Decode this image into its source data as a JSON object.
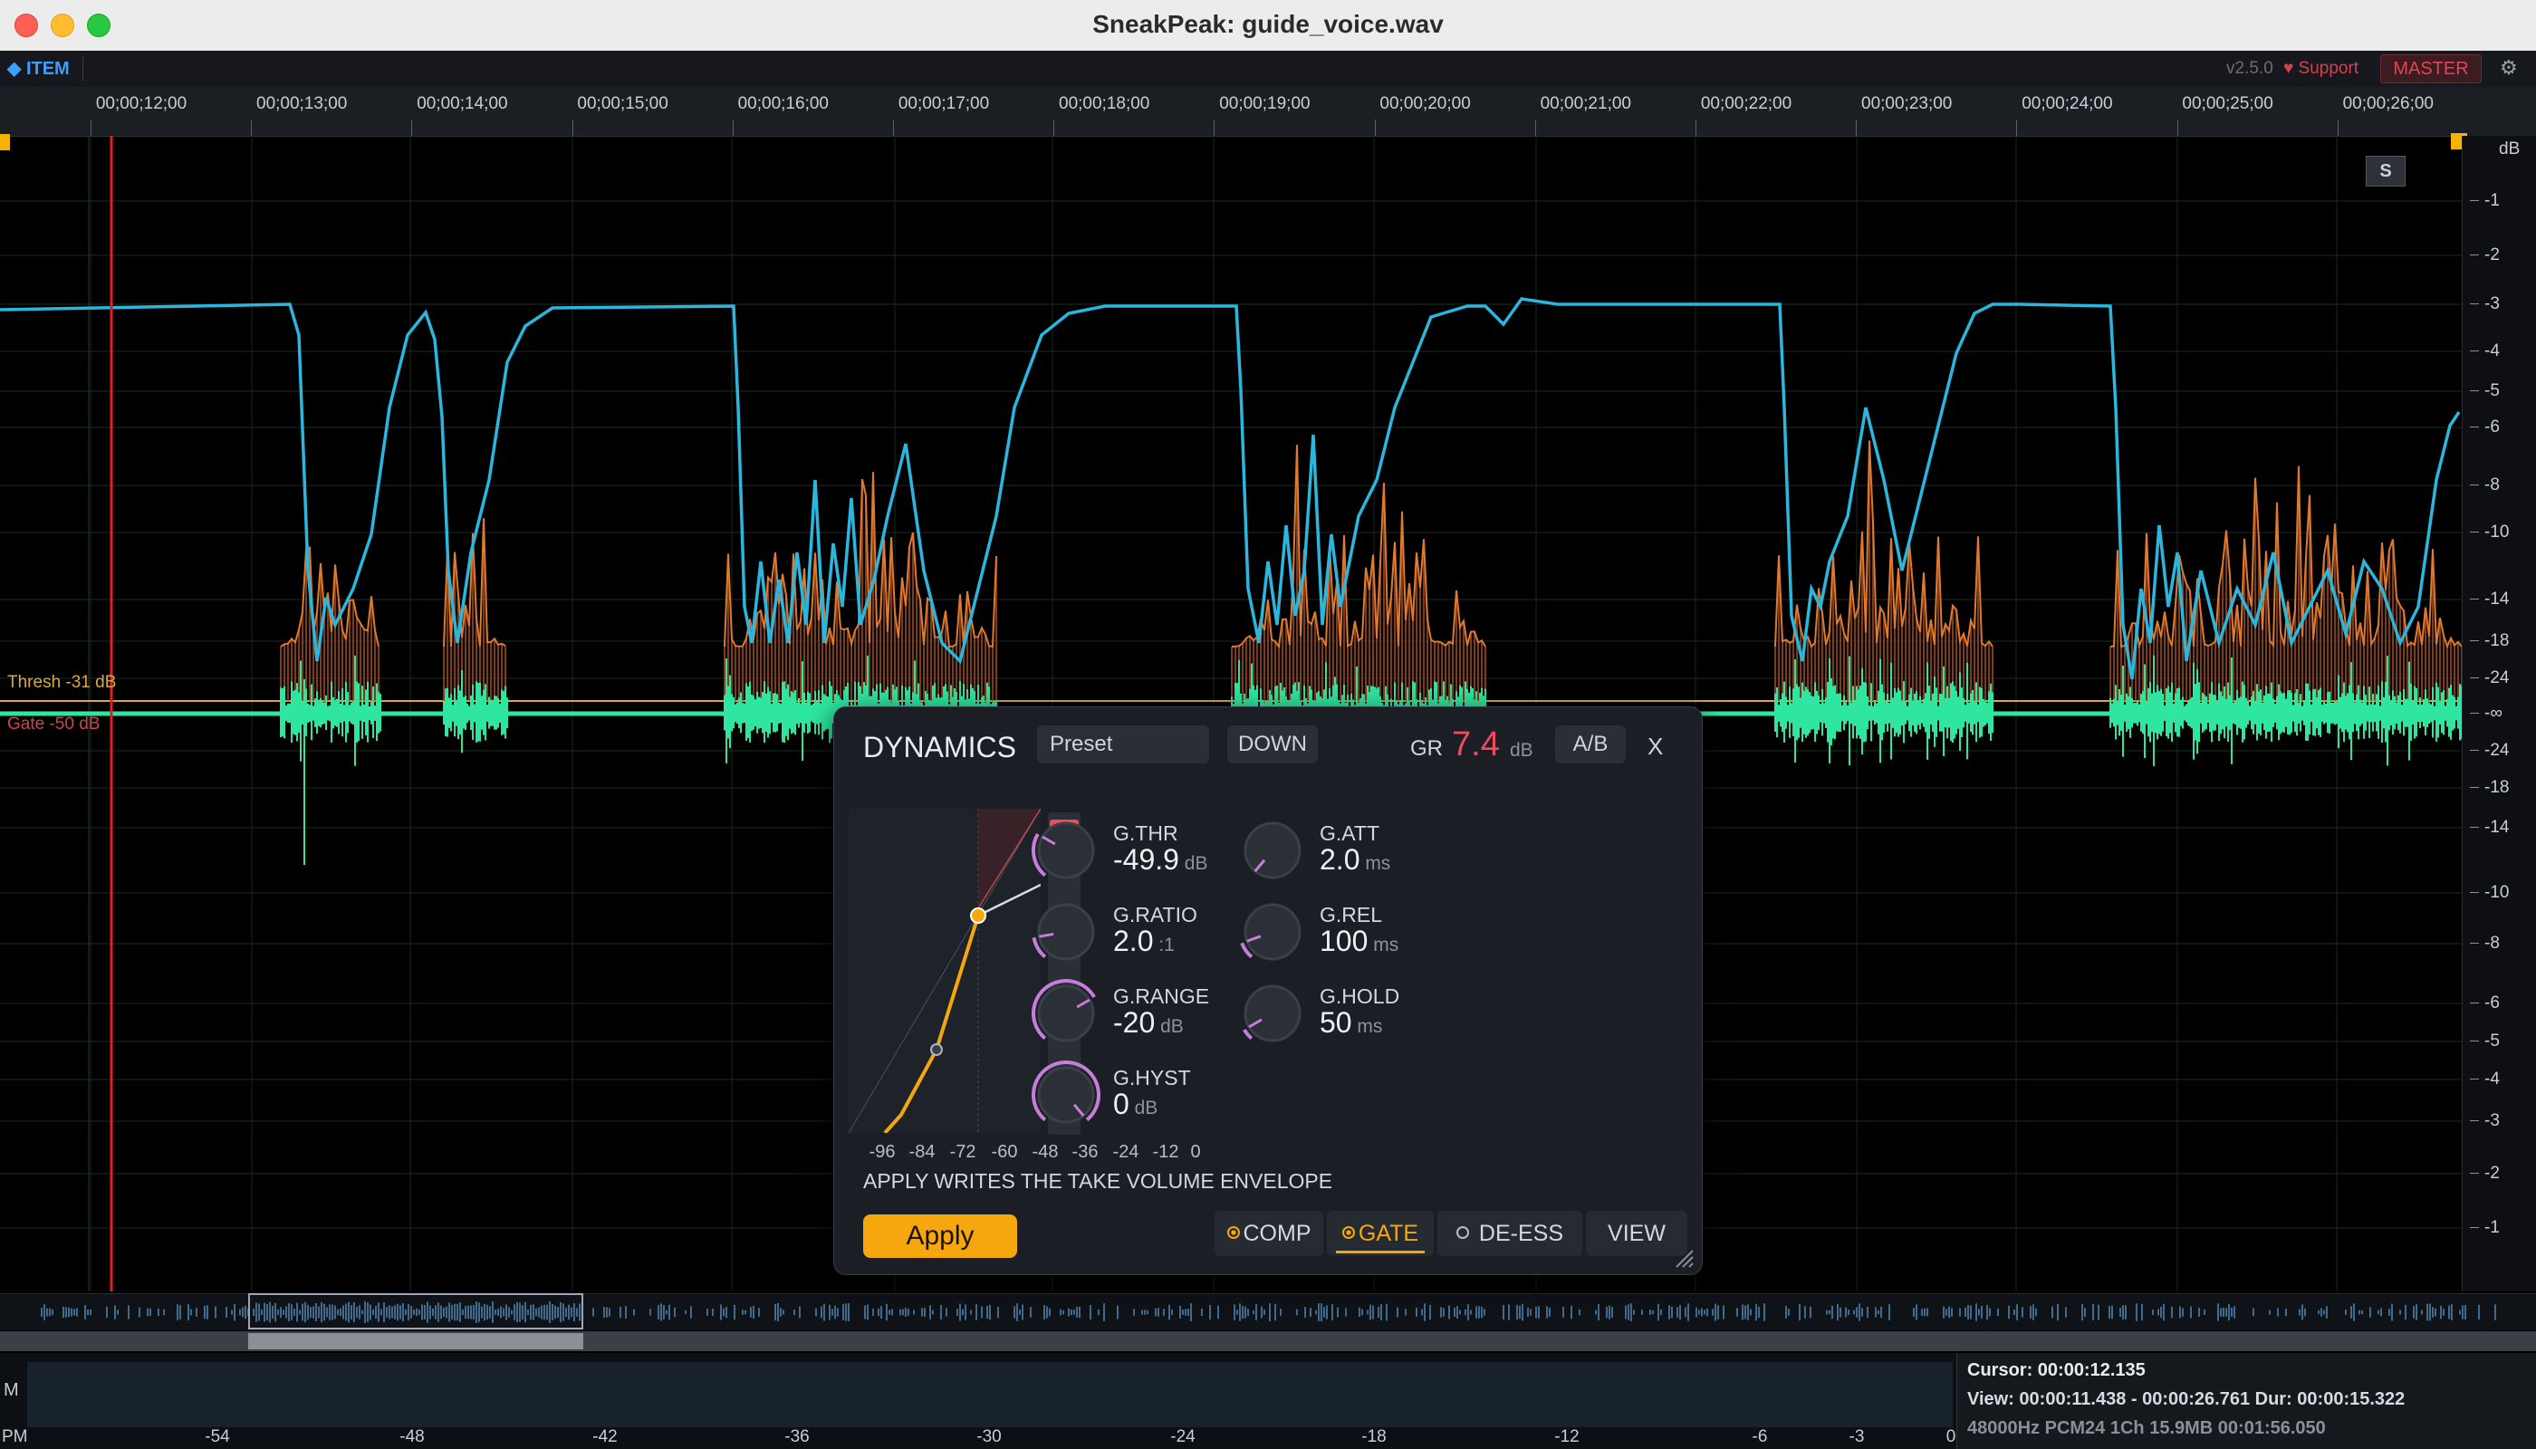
{
  "window": {
    "title": "SneakPeak: guide_voice.wav"
  },
  "toolbar": {
    "item_label": "◆ ITEM",
    "version": "v2.5.0",
    "support": "♥ Support",
    "master": "MASTER",
    "settings_icon": "gear-icon"
  },
  "ruler": {
    "ticks": [
      "00;00;12;00",
      "00;00;13;00",
      "00;00;14;00",
      "00;00;15;00",
      "00;00;16;00",
      "00;00;17;00",
      "00;00;18;00",
      "00;00;19;00",
      "00;00;20;00",
      "00;00;21;00",
      "00;00;22;00",
      "00;00;23;00",
      "00;00;24;00",
      "00;00;25;00",
      "00;00;26;00"
    ]
  },
  "waveform": {
    "solo_button": "S",
    "thresh_label": "Thresh -31 dB",
    "gate_label": "Gate -50 dB",
    "db_unit": "dB",
    "db_ticks": [
      "-1",
      "-2",
      "-3",
      "-4",
      "-5",
      "-6",
      "-8",
      "-10",
      "-14",
      "-18",
      "-24",
      "-∞",
      "-24",
      "-18",
      "-14",
      "-10",
      "-8",
      "-6",
      "-5",
      "-4",
      "-3",
      "-2",
      "-1"
    ]
  },
  "meter": {
    "label": "M",
    "pm_label": "PM",
    "ticks": [
      "-54",
      "-48",
      "-42",
      "-36",
      "-30",
      "-24",
      "-18",
      "-12",
      "-6",
      "-3",
      "0"
    ]
  },
  "status": {
    "cursor": "Cursor: 00:00:12.135",
    "view": "View: 00:00:11.438 - 00:00:26.761  Dur: 00:00:15.322",
    "format": "48000Hz PCM24 1Ch  15.9MB  00:01:56.050"
  },
  "dynamics": {
    "title": "DYNAMICS",
    "preset": "Preset",
    "mode": "DOWN",
    "gr_label": "GR",
    "gr_value": "7.4",
    "gr_unit": "dB",
    "ab": "A/B",
    "close": "X",
    "graph_ticks": [
      "-96",
      "-84",
      "-72",
      "-60",
      "-48",
      "-36",
      "-24",
      "-12",
      "0"
    ],
    "knobs": [
      {
        "label": "G.THR",
        "value": "-49.9",
        "unit": "dB"
      },
      {
        "label": "G.ATT",
        "value": "2.0",
        "unit": "ms"
      },
      {
        "label": "G.RATIO",
        "value": "2.0",
        "unit": ":1"
      },
      {
        "label": "G.REL",
        "value": "100",
        "unit": "ms"
      },
      {
        "label": "G.RANGE",
        "value": "-20",
        "unit": "dB"
      },
      {
        "label": "G.HOLD",
        "value": "50",
        "unit": "ms"
      },
      {
        "label": "G.HYST",
        "value": "0",
        "unit": "dB"
      }
    ],
    "note": "APPLY WRITES THE TAKE VOLUME ENVELOPE",
    "apply": "Apply",
    "tabs": [
      "COMP",
      "GATE",
      "DE-ESS",
      "VIEW"
    ]
  },
  "colors": {
    "accent": "#f5a70d",
    "waveform": "#2ee6a0",
    "envelope": "#2bb6dd",
    "gain": "#e07a2e",
    "playhead": "#e01f2a",
    "threshold": "#d9a93a"
  }
}
